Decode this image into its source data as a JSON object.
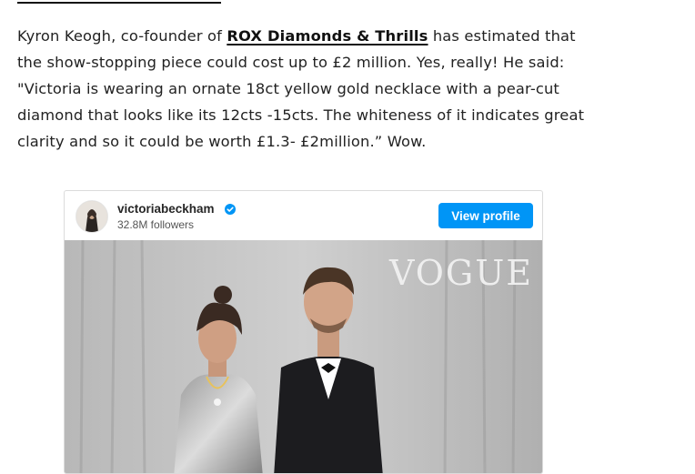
{
  "article": {
    "text_before_link": "Kyron Keogh, co-founder of ",
    "link_text": "ROX Diamonds & Thrills",
    "text_after_link": " has estimated that the show-stopping piece could cost up to £2 million. Yes, really! He said: \"Victoria is wearing an ornate 18ct yellow gold necklace with a pear-cut diamond that looks like its 12cts -15cts. The whiteness of it indicates great clarity and so it could be worth £1.3- £2million.” Wow."
  },
  "instagram_embed": {
    "username": "victoriabeckham",
    "followers": "32.8M followers",
    "view_profile_label": "View profile",
    "image_watermark": "VOGUE",
    "colors": {
      "button": "#0095f6",
      "verified": "#0095f6",
      "backdrop": "#bdbdbd"
    }
  }
}
